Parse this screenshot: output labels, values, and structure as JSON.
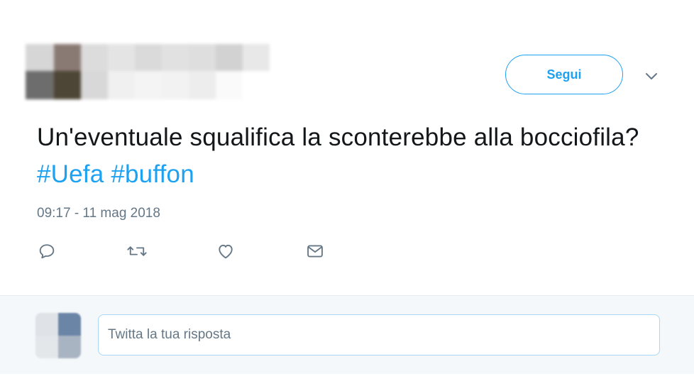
{
  "header": {
    "follow_label": "Segui"
  },
  "tweet": {
    "text_plain": "Un'eventuale squalifica la sconterebbe alla bocciofila?",
    "hashtags": [
      "#Uefa",
      "#buffon"
    ],
    "timestamp": "09:17 - 11 mag 2018"
  },
  "actions": [
    {
      "icon": "reply-icon"
    },
    {
      "icon": "retweet-icon"
    },
    {
      "icon": "like-icon"
    },
    {
      "icon": "direct-message-icon"
    }
  ],
  "reply": {
    "placeholder": "Twitta la tua risposta"
  },
  "colors": {
    "accent": "#1da1f2",
    "text": "#14171a",
    "secondary_text": "#657786",
    "reply_background": "#f5f8fa"
  }
}
